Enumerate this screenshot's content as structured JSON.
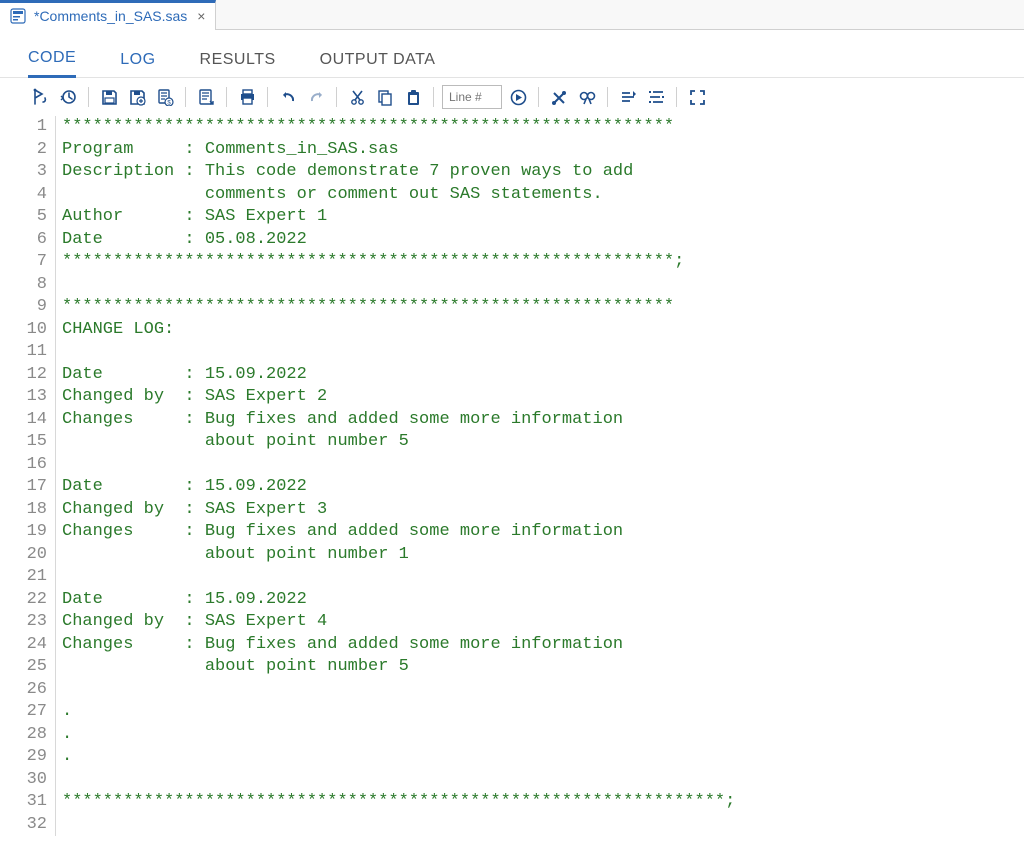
{
  "file_tab": {
    "label": "*Comments_in_SAS.sas",
    "close_glyph": "×"
  },
  "view_tabs": {
    "code": "CODE",
    "log": "LOG",
    "results": "RESULTS",
    "output_data": "OUTPUT DATA"
  },
  "toolbar": {
    "line_placeholder": "Line #"
  },
  "code_lines": [
    "************************************************************",
    "Program     : Comments_in_SAS.sas",
    "Description : This code demonstrate 7 proven ways to add",
    "              comments or comment out SAS statements.",
    "Author      : SAS Expert 1",
    "Date        : 05.08.2022",
    "************************************************************;",
    "",
    "************************************************************",
    "CHANGE LOG:",
    "",
    "Date        : 15.09.2022",
    "Changed by  : SAS Expert 2",
    "Changes     : Bug fixes and added some more information",
    "              about point number 5",
    "",
    "Date        : 15.09.2022",
    "Changed by  : SAS Expert 3",
    "Changes     : Bug fixes and added some more information",
    "              about point number 1",
    "",
    "Date        : 15.09.2022",
    "Changed by  : SAS Expert 4",
    "Changes     : Bug fixes and added some more information",
    "              about point number 5",
    "",
    ".",
    ".",
    ".",
    "",
    "*****************************************************************;",
    ""
  ],
  "line_numbers": [
    "1",
    "2",
    "3",
    "4",
    "5",
    "6",
    "7",
    "8",
    "9",
    "10",
    "11",
    "12",
    "13",
    "14",
    "15",
    "16",
    "17",
    "18",
    "19",
    "20",
    "21",
    "22",
    "23",
    "24",
    "25",
    "26",
    "27",
    "28",
    "29",
    "30",
    "31",
    "32"
  ]
}
